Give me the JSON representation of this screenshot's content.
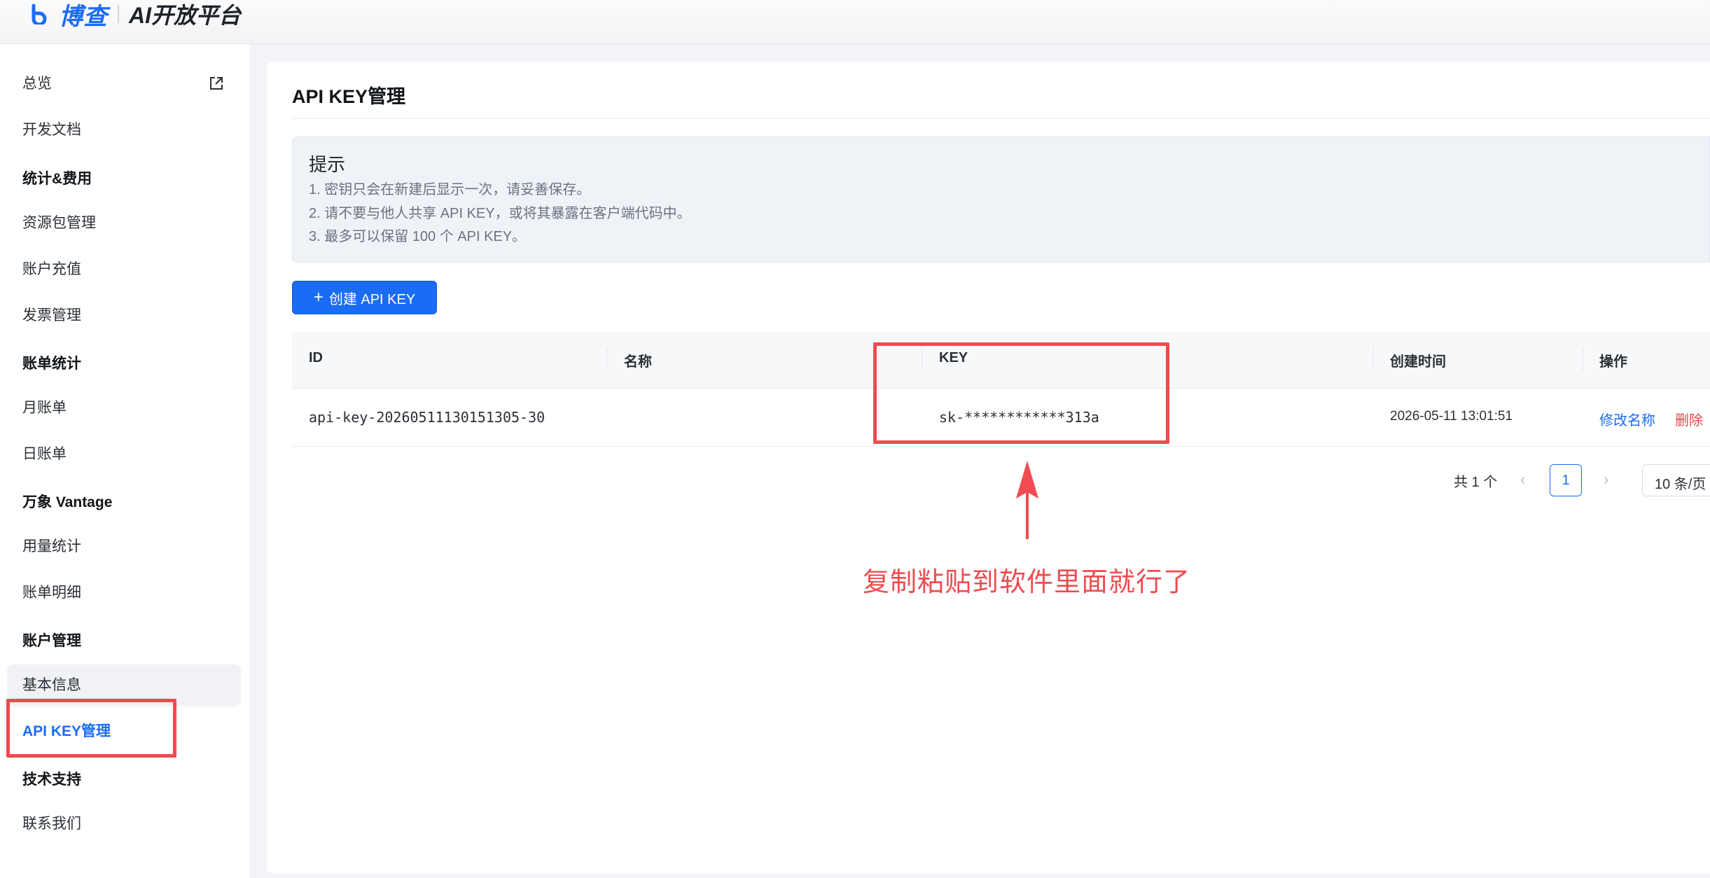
{
  "header": {
    "brand": "博查",
    "platform": "AI开放平台"
  },
  "sidebar": {
    "items": [
      {
        "label": "总览",
        "type": "item"
      },
      {
        "label": "开发文档",
        "type": "item",
        "icon": "external-link-icon"
      },
      {
        "label": "统计&费用",
        "type": "group"
      },
      {
        "label": "资源包管理",
        "type": "item"
      },
      {
        "label": "账户充值",
        "type": "item"
      },
      {
        "label": "发票管理",
        "type": "item"
      },
      {
        "label": "账单统计",
        "type": "group"
      },
      {
        "label": "月账单",
        "type": "item"
      },
      {
        "label": "日账单",
        "type": "item"
      },
      {
        "label": "万象 Vantage",
        "type": "group"
      },
      {
        "label": "用量统计",
        "type": "item"
      },
      {
        "label": "账单明细",
        "type": "item"
      },
      {
        "label": "账户管理",
        "type": "group"
      },
      {
        "label": "基本信息",
        "type": "item"
      },
      {
        "label": "API KEY管理",
        "type": "item",
        "active": true
      },
      {
        "label": "技术支持",
        "type": "group"
      },
      {
        "label": "联系我们",
        "type": "item"
      }
    ]
  },
  "main": {
    "title": "API KEY管理",
    "tip": {
      "title": "提示",
      "lines": [
        "1. 密钥只会在新建后显示一次，请妥善保存。",
        "2. 请不要与他人共享 API KEY，或将其暴露在客户端代码中。",
        "3. 最多可以保留 100 个 API KEY。"
      ]
    },
    "create_button": "创建 API KEY",
    "table": {
      "columns": [
        "ID",
        "名称",
        "KEY",
        "创建时间",
        "操作"
      ],
      "rows": [
        {
          "id": "api-key-20260511130151305-30",
          "name": "",
          "key": "sk-************313a",
          "created": "2026-05-11 13:01:51",
          "actions": [
            "修改名称",
            "删除"
          ]
        }
      ]
    },
    "pagination": {
      "total": "共 1 个",
      "current_page": "1",
      "page_size": "10 条/页"
    }
  },
  "annotation": {
    "text": "复制粘贴到软件里面就行了"
  },
  "colors": {
    "accent": "#1a6cf5",
    "annotation": "#ef4b50",
    "danger": "#e5484d"
  }
}
